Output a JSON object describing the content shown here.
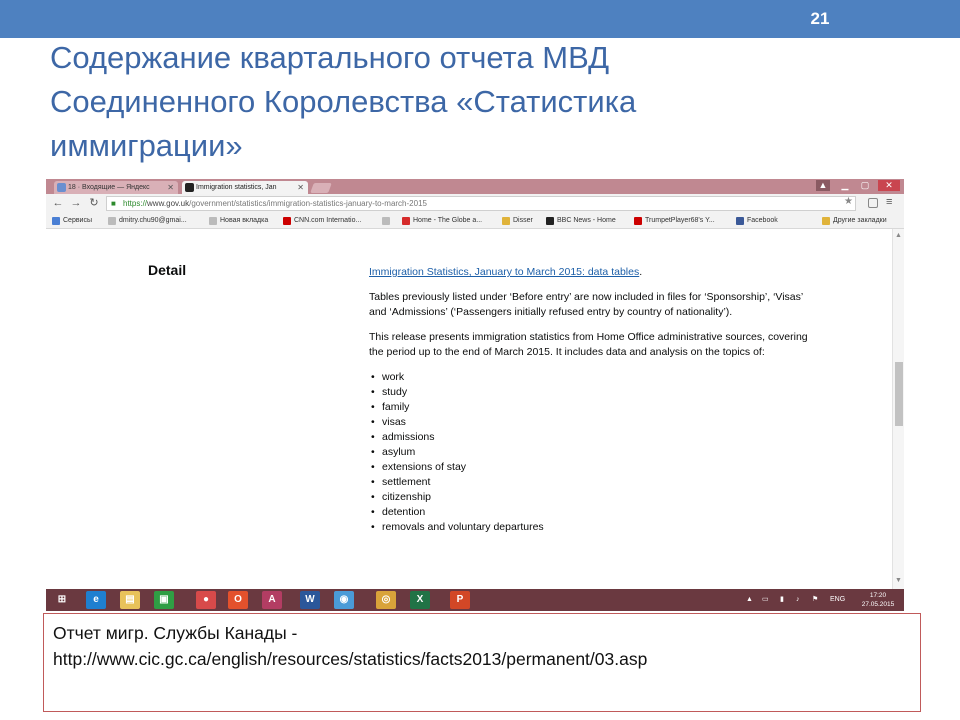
{
  "slide": {
    "number": "21",
    "title_lines": [
      "Содержание  квартального  отчета МВД",
      "Соединенного Королевства  «Статистика",
      "иммиграции»"
    ]
  },
  "browser": {
    "tabs": [
      {
        "label": "18 · Входящие — Яндекс",
        "icon": "mail-icon"
      },
      {
        "label": "Immigration statistics, Jan",
        "icon": "gov-uk-icon"
      }
    ],
    "address": {
      "scheme": "https://",
      "host": "www.gov.uk",
      "path": "/government/statistics/immigration-statistics-january-to-march-2015"
    },
    "bookmarks": [
      {
        "label": "Сервисы",
        "icon": "apps-icon",
        "color": "#4a7fd4"
      },
      {
        "label": "dmitry.chu90@gmai...",
        "icon": "page-icon",
        "color": "#bbbbbb"
      },
      {
        "label": "Новая вкладка",
        "icon": "page-icon",
        "color": "#bbbbbb"
      },
      {
        "label": "CNN.com Internatio...",
        "icon": "cnn-icon",
        "color": "#cc0000"
      },
      {
        "label": "",
        "icon": "page-icon",
        "color": "#bbbbbb"
      },
      {
        "label": "Home - The Globe a...",
        "icon": "maple-leaf-icon",
        "color": "#d62b2b"
      },
      {
        "label": "Disser",
        "icon": "folder-icon",
        "color": "#e0b33a"
      },
      {
        "label": "BBC News - Home",
        "icon": "bbc-icon",
        "color": "#222222"
      },
      {
        "label": "TrumpetPlayer68's Y...",
        "icon": "youtube-icon",
        "color": "#cc0000"
      },
      {
        "label": "Facebook",
        "icon": "facebook-icon",
        "color": "#3b5998"
      },
      {
        "label": "Другие закладки",
        "icon": "folder-icon",
        "color": "#e0b33a"
      }
    ]
  },
  "page": {
    "heading": "Detail",
    "link_text": "Immigration Statistics, January to March 2015: data tables",
    "link_suffix": ".",
    "paragraph1": "Tables previously listed under ‘Before entry’ are now included in files for ‘Sponsorship’, ‘Visas’ and ‘Admissions’ (‘Passengers initially refused entry by country of nationality’).",
    "paragraph2": "This release presents immigration statistics from Home Office administrative sources, covering the period up to the end of March 2015. It includes data and analysis on the topics of:",
    "topics": [
      "work",
      "study",
      "family",
      "visas",
      "admissions",
      "asylum",
      "extensions of stay",
      "settlement",
      "citizenship",
      "detention",
      "removals and voluntary departures"
    ]
  },
  "taskbar": {
    "apps": [
      {
        "icon": "windows-start-icon",
        "glyph": "⊞",
        "color": "#6a3940"
      },
      {
        "icon": "internet-explorer-icon",
        "glyph": "e",
        "color": "#1e7fd0"
      },
      {
        "icon": "file-explorer-icon",
        "glyph": "▤",
        "color": "#e8c25a"
      },
      {
        "icon": "store-icon",
        "glyph": "▣",
        "color": "#2f9e44"
      },
      {
        "icon": "media-icon",
        "glyph": "●",
        "color": "#d84a4a"
      },
      {
        "icon": "office-icon",
        "glyph": "O",
        "color": "#e4512c"
      },
      {
        "icon": "access-icon",
        "glyph": "A",
        "color": "#b33d63"
      },
      {
        "icon": "word-icon",
        "glyph": "W",
        "color": "#2b579a"
      },
      {
        "icon": "network-icon",
        "glyph": "◉",
        "color": "#4a9bd8"
      },
      {
        "icon": "chrome-icon",
        "glyph": "◎",
        "color": "#d9a33a"
      },
      {
        "icon": "excel-icon",
        "glyph": "X",
        "color": "#217346"
      },
      {
        "icon": "powerpoint-icon",
        "glyph": "P",
        "color": "#d24726"
      }
    ],
    "language": "ENG",
    "time": "17:20",
    "date": "27.05.2015"
  },
  "note": {
    "line1": "Отчет  мигр. Службы Канады -",
    "line2": "http://www.cic.gc.ca/english/resources/statistics/facts2013/permanent/03.asp"
  }
}
